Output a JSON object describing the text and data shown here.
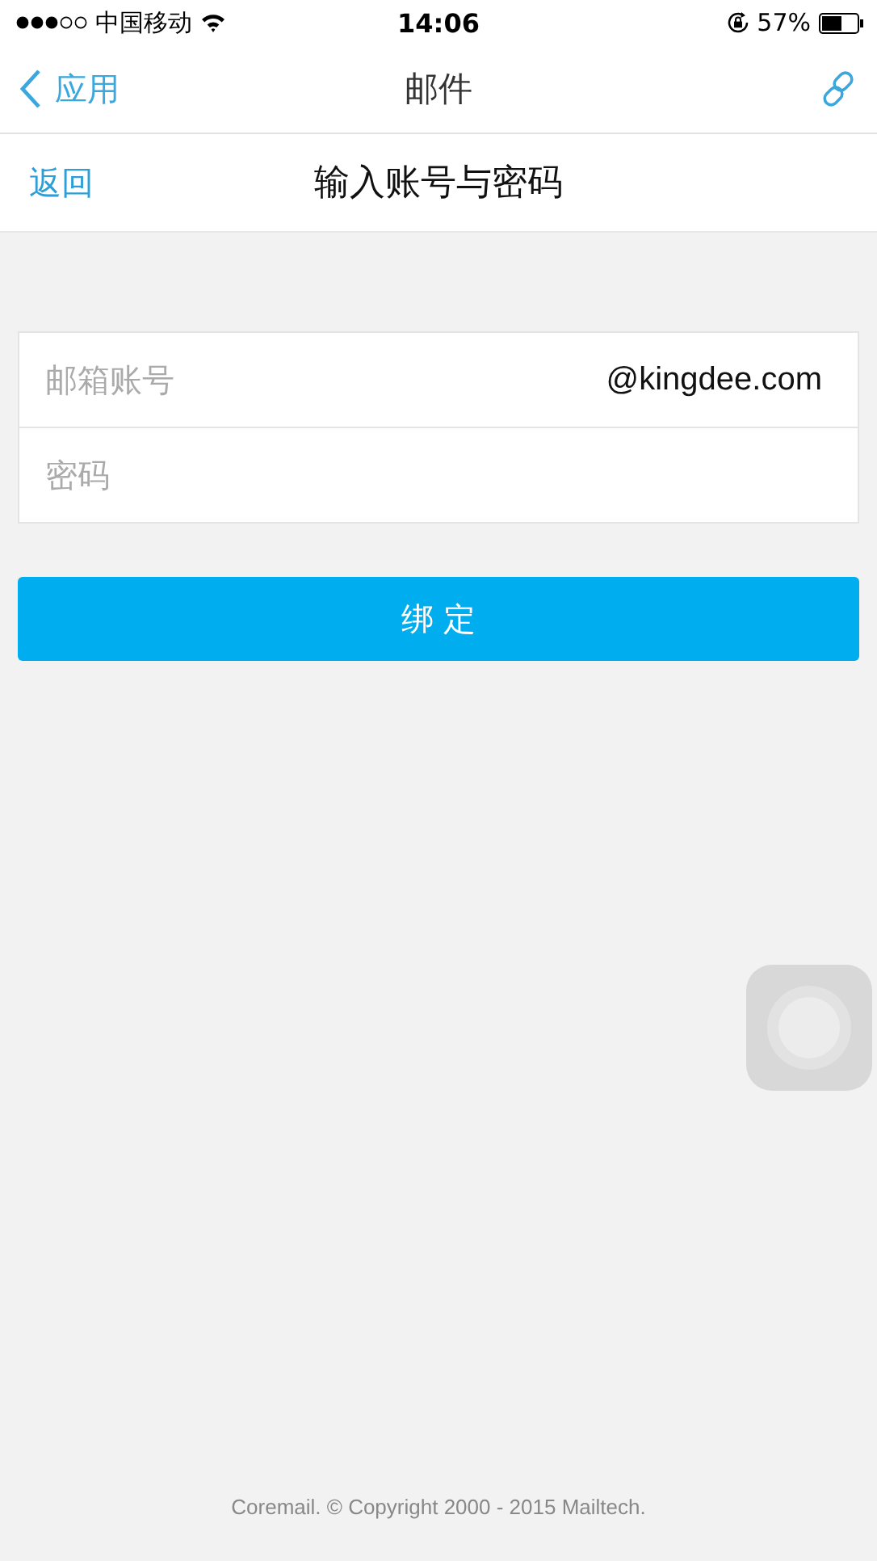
{
  "status_bar": {
    "carrier": "中国移动",
    "time": "14:06",
    "battery": "57%"
  },
  "nav": {
    "back": "应用",
    "title": "邮件"
  },
  "subheader": {
    "back": "返回",
    "title": "输入账号与密码"
  },
  "form": {
    "account": {
      "placeholder": "邮箱账号",
      "suffix": "@kingdee.com"
    },
    "password": {
      "placeholder": "密码"
    }
  },
  "submit": "绑 定",
  "footer": "Coremail. © Copyright 2000 - 2015 Mailtech."
}
